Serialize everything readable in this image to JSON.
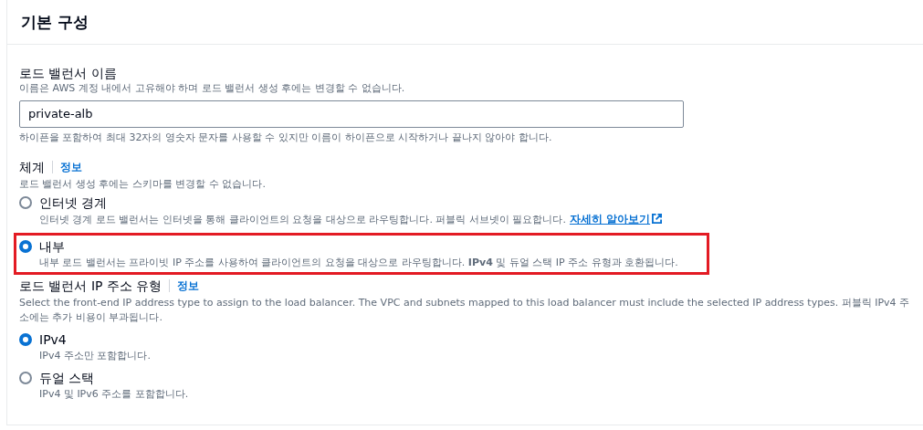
{
  "panel": {
    "title": "기본 구성"
  },
  "name_field": {
    "label": "로드 밸런서 이름",
    "description": "이름은 AWS 계정 내에서 고유해야 하며 로드 밸런서 생성 후에는 변경할 수 없습니다.",
    "value": "private-alb",
    "hint": "하이픈을 포함하여 최대 32자의 영숫자 문자를 사용할 수 있지만 이름이 하이픈으로 시작하거나 끝나지 않아야 합니다."
  },
  "scheme": {
    "label": "체계",
    "info": "정보",
    "description": "로드 밸런서 생성 후에는 스키마를 변경할 수 없습니다.",
    "options": [
      {
        "label": "인터넷 경계",
        "description": "인터넷 경계 로드 밸런서는 인터넷을 통해 클라이언트의 요청을 대상으로 라우팅합니다. 퍼블릭 서브넷이 필요합니다.",
        "link": "자세히 알아보기",
        "selected": false,
        "highlighted": false
      },
      {
        "label": "내부",
        "description": "내부 로드 밸런서는 프라이빗 IP 주소를 사용하여 클라이언트의 요청을 대상으로 라우팅합니다. **IPv4** 및 듀얼 스택 IP 주소 유형과 호환됩니다.",
        "selected": true,
        "highlighted": true
      }
    ]
  },
  "ip_type": {
    "label": "로드 밸런서 IP 주소 유형",
    "info": "정보",
    "description": "Select the front-end IP address type to assign to the load balancer. The VPC and subnets mapped to this load balancer must include the selected IP address types. 퍼블릭 IPv4 주소에는 추가 비용이 부과됩니다.",
    "options": [
      {
        "label": "IPv4",
        "description": "IPv4 주소만 포함합니다.",
        "selected": true,
        "highlighted": false
      },
      {
        "label": "듀얼 스택",
        "description": "IPv4 및 IPv6 주소를 포함합니다.",
        "selected": false,
        "highlighted": false
      }
    ]
  }
}
